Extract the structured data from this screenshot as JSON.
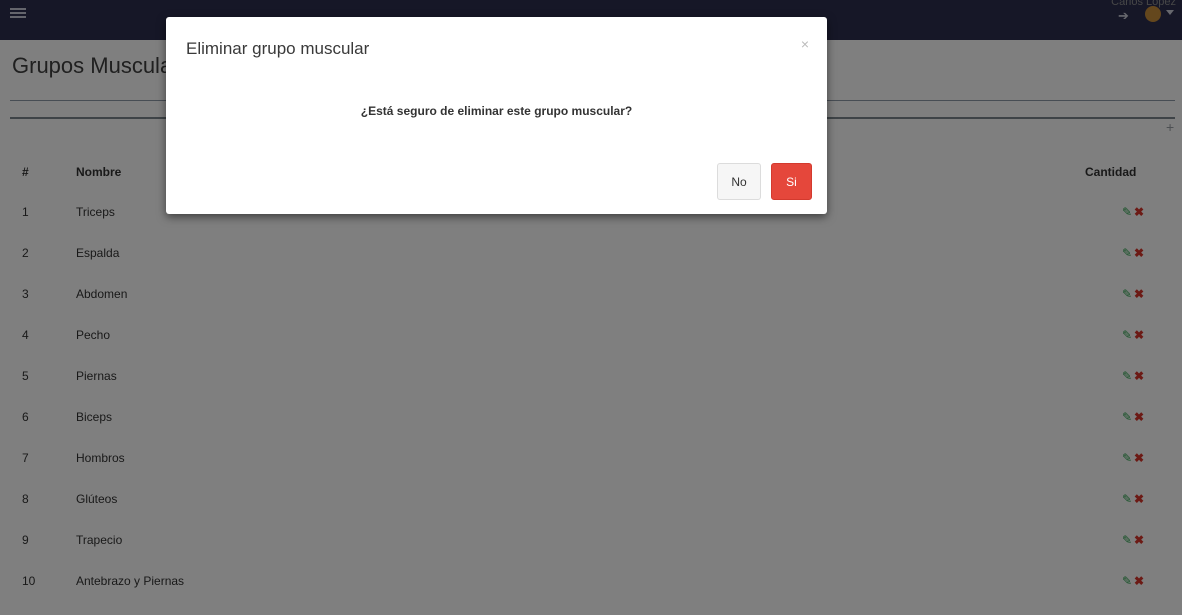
{
  "topbar": {
    "user_text": "Carlos Lopez"
  },
  "page": {
    "title": "Grupos Musculares"
  },
  "table": {
    "headers": {
      "num": "#",
      "name": "Nombre",
      "actions": "Cantidad"
    },
    "rows": [
      {
        "num": "1",
        "name": "Triceps"
      },
      {
        "num": "2",
        "name": "Espalda"
      },
      {
        "num": "3",
        "name": "Abdomen"
      },
      {
        "num": "4",
        "name": "Pecho"
      },
      {
        "num": "5",
        "name": "Piernas"
      },
      {
        "num": "6",
        "name": "Biceps"
      },
      {
        "num": "7",
        "name": "Hombros"
      },
      {
        "num": "8",
        "name": "Glúteos"
      },
      {
        "num": "9",
        "name": "Trapecio"
      },
      {
        "num": "10",
        "name": "Antebrazo y Piernas"
      }
    ],
    "edit_icon": "pencil-icon",
    "delete_icon": "times-icon"
  },
  "modal": {
    "title": "Eliminar grupo muscular",
    "close": "×",
    "message": "¿Está seguro de eliminar este grupo muscular?",
    "no_label": "No",
    "yes_label": "Si"
  },
  "colors": {
    "topbar": "#2d2f4f",
    "danger": "#e5473b",
    "edit": "#2aa24b"
  }
}
